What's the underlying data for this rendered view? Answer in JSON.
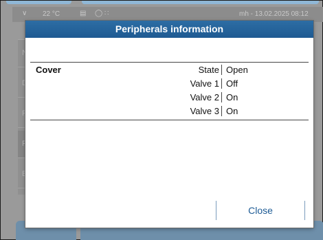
{
  "statusbar": {
    "temperature": "22 °C",
    "user_datetime": "mh - 13.02.2025 08:12",
    "icons": [
      "chevron-down-icon",
      "printer-icon",
      "beaker-icon",
      "network-icon"
    ]
  },
  "background_list": {
    "rows": [
      {
        "label": "N"
      },
      {
        "label": "D"
      },
      {
        "label": "F"
      },
      {
        "label": "F"
      },
      {
        "label": "E"
      }
    ]
  },
  "dialog": {
    "title": "Peripherals information",
    "table": {
      "group": "Cover",
      "rows": [
        {
          "key": "State",
          "value": "Open"
        },
        {
          "key": "Valve 1",
          "value": "Off"
        },
        {
          "key": "Valve 2",
          "value": "On"
        },
        {
          "key": "Valve 3",
          "value": "On"
        }
      ]
    },
    "close_label": "Close"
  },
  "colors": {
    "title_bar": "#1e5a92",
    "accent_text": "#1d5b95",
    "overlay": "#9a9a9a"
  }
}
